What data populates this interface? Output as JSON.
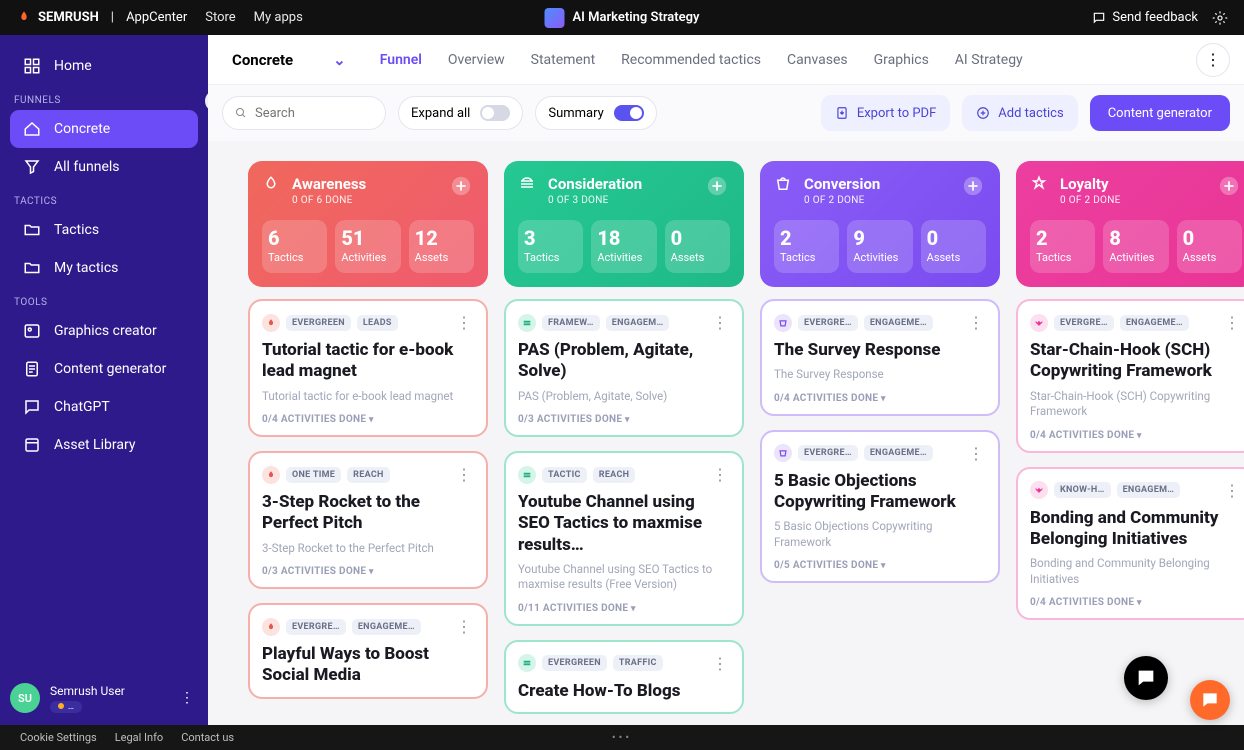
{
  "topbar": {
    "brand": "SEMRUSH",
    "appcenter": "AppCenter",
    "store": "Store",
    "myapps": "My apps",
    "appname": "AI Marketing Strategy",
    "feedback": "Send feedback"
  },
  "sidebar": {
    "home": "Home",
    "sections": {
      "funnels": "FUNNELS",
      "tactics": "TACTICS",
      "tools": "TOOLS"
    },
    "funnel_items": {
      "concrete": "Concrete",
      "all": "All funnels"
    },
    "tactic_items": {
      "tactics": "Tactics",
      "mytactics": "My tactics"
    },
    "tool_items": {
      "graphics": "Graphics creator",
      "content": "Content generator",
      "chatgpt": "ChatGPT",
      "assets": "Asset Library"
    },
    "user": {
      "initials": "SU",
      "name": "Semrush User",
      "plan": "…"
    }
  },
  "header": {
    "workspace": "Concrete",
    "tabs": {
      "funnel": "Funnel",
      "overview": "Overview",
      "statement": "Statement",
      "recommended": "Recommended tactics",
      "canvases": "Canvases",
      "graphics": "Graphics",
      "aistrategy": "AI Strategy"
    }
  },
  "toolbar": {
    "search_placeholder": "Search",
    "expand": "Expand all",
    "summary": "Summary",
    "export": "Export to PDF",
    "add": "Add tactics",
    "generator": "Content generator"
  },
  "columns": [
    {
      "key": "awareness",
      "title": "Awareness",
      "sub": "0 OF 6 DONE",
      "stats": [
        {
          "num": "6",
          "lbl": "Tactics"
        },
        {
          "num": "51",
          "lbl": "Activities"
        },
        {
          "num": "12",
          "lbl": "Assets"
        }
      ],
      "cards": [
        {
          "chips": [
            "EVERGREEN",
            "LEADS"
          ],
          "title": "Tutorial tactic for e-book lead magnet",
          "desc": "Tutorial tactic for e-book lead magnet",
          "done": "0/4 ACTIVITIES DONE"
        },
        {
          "chips": [
            "ONE TIME",
            "REACH"
          ],
          "title": "3-Step Rocket to the Perfect Pitch",
          "desc": "3-Step Rocket to the Perfect Pitch",
          "done": "0/3 ACTIVITIES DONE"
        },
        {
          "chips": [
            "EVERGRE…",
            "ENGAGEME…"
          ],
          "title": "Playful Ways to Boost Social Media",
          "desc": "",
          "done": ""
        }
      ]
    },
    {
      "key": "consideration",
      "title": "Consideration",
      "sub": "0 OF 3 DONE",
      "stats": [
        {
          "num": "3",
          "lbl": "Tactics"
        },
        {
          "num": "18",
          "lbl": "Activities"
        },
        {
          "num": "0",
          "lbl": "Assets"
        }
      ],
      "cards": [
        {
          "chips": [
            "FRAMEW…",
            "ENGAGEM…"
          ],
          "title": "PAS (Problem, Agitate, Solve)",
          "desc": "PAS (Problem, Agitate, Solve)",
          "done": "0/3 ACTIVITIES DONE"
        },
        {
          "chips": [
            "TACTIC",
            "REACH"
          ],
          "title": "Youtube Channel using SEO Tactics to maxmise results…",
          "desc": "Youtube Channel using SEO Tactics to maxmise results (Free Version)",
          "done": "0/11 ACTIVITIES DONE"
        },
        {
          "chips": [
            "EVERGREEN",
            "TRAFFIC"
          ],
          "title": "Create How-To Blogs",
          "desc": "",
          "done": ""
        }
      ]
    },
    {
      "key": "conversion",
      "title": "Conversion",
      "sub": "0 OF 2 DONE",
      "stats": [
        {
          "num": "2",
          "lbl": "Tactics"
        },
        {
          "num": "9",
          "lbl": "Activities"
        },
        {
          "num": "0",
          "lbl": "Assets"
        }
      ],
      "cards": [
        {
          "chips": [
            "EVERGRE…",
            "ENGAGEME…"
          ],
          "title": "The Survey Response",
          "desc": "The Survey Response",
          "done": "0/4 ACTIVITIES DONE"
        },
        {
          "chips": [
            "EVERGRE…",
            "ENGAGEME…"
          ],
          "title": "5 Basic Objections Copywriting Framework",
          "desc": "5 Basic Objections Copywriting Framework",
          "done": "0/5 ACTIVITIES DONE"
        }
      ]
    },
    {
      "key": "loyalty",
      "title": "Loyalty",
      "sub": "0 OF 2 DONE",
      "stats": [
        {
          "num": "2",
          "lbl": "Tactics"
        },
        {
          "num": "8",
          "lbl": "Activities"
        },
        {
          "num": "0",
          "lbl": "Assets"
        }
      ],
      "cards": [
        {
          "chips": [
            "EVERGRE…",
            "ENGAGEME…"
          ],
          "title": "Star-Chain-Hook (SCH) Copywriting Framework",
          "desc": "Star-Chain-Hook (SCH) Copywriting Framework",
          "done": "0/4 ACTIVITIES DONE"
        },
        {
          "chips": [
            "KNOW-H…",
            "ENGAGEM…"
          ],
          "title": "Bonding and Community Belonging Initiatives",
          "desc": "Bonding and Community Belonging Initiatives",
          "done": "0/4 ACTIVITIES DONE"
        }
      ]
    }
  ],
  "footer": {
    "cookies": "Cookie Settings",
    "legal": "Legal Info",
    "contact": "Contact us"
  }
}
